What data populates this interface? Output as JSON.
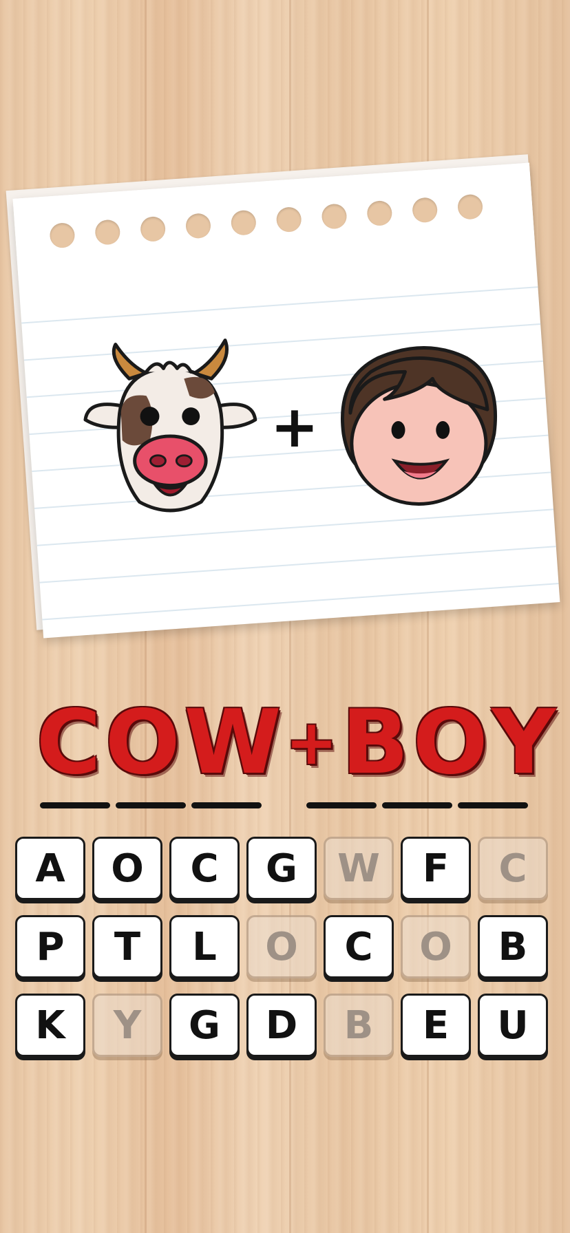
{
  "clue": {
    "left_image": "cow-face-icon",
    "operator": "+",
    "right_image": "boy-face-icon"
  },
  "answer": {
    "letters": [
      "C",
      "O",
      "W",
      "+",
      "B",
      "O",
      "Y"
    ]
  },
  "keyboard": {
    "rows": [
      [
        {
          "l": "A",
          "used": false
        },
        {
          "l": "O",
          "used": false
        },
        {
          "l": "C",
          "used": false
        },
        {
          "l": "G",
          "used": false
        },
        {
          "l": "W",
          "used": true
        },
        {
          "l": "F",
          "used": false
        },
        {
          "l": "C",
          "used": true
        }
      ],
      [
        {
          "l": "P",
          "used": false
        },
        {
          "l": "T",
          "used": false
        },
        {
          "l": "L",
          "used": false
        },
        {
          "l": "O",
          "used": true
        },
        {
          "l": "C",
          "used": false
        },
        {
          "l": "O",
          "used": true
        },
        {
          "l": "B",
          "used": false
        }
      ],
      [
        {
          "l": "K",
          "used": false
        },
        {
          "l": "Y",
          "used": true
        },
        {
          "l": "G",
          "used": false
        },
        {
          "l": "D",
          "used": false
        },
        {
          "l": "B",
          "used": true
        },
        {
          "l": "E",
          "used": false
        },
        {
          "l": "U",
          "used": false
        }
      ]
    ]
  },
  "colors": {
    "answer_red": "#d41c1c",
    "wood": "#e9c8a6"
  }
}
